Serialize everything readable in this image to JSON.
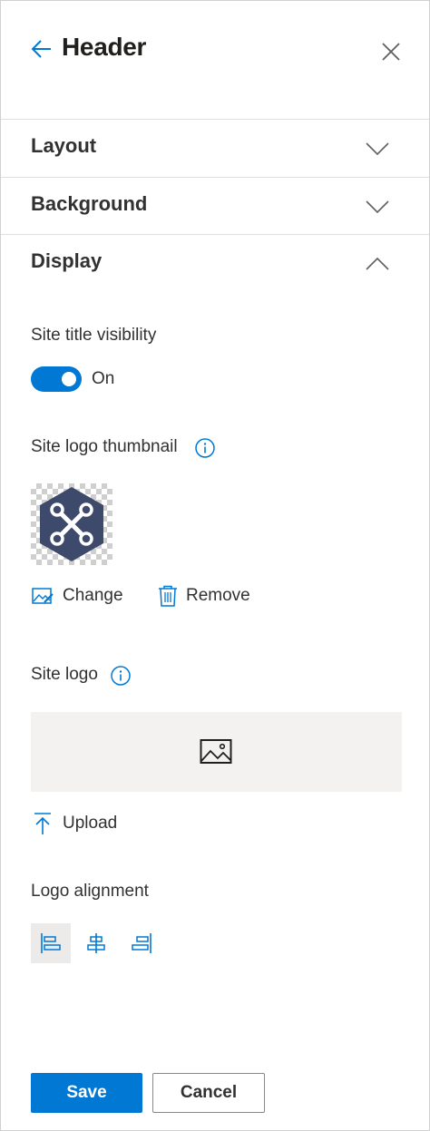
{
  "header": {
    "title": "Header"
  },
  "sections": {
    "layout": {
      "label": "Layout",
      "expanded": false
    },
    "background": {
      "label": "Background",
      "expanded": false
    },
    "display": {
      "label": "Display",
      "expanded": true
    }
  },
  "display": {
    "site_title_visibility": {
      "label": "Site title visibility",
      "toggle_state": "On",
      "checked": true
    },
    "site_logo_thumbnail": {
      "label": "Site logo thumbnail",
      "change_label": "Change",
      "remove_label": "Remove"
    },
    "site_logo": {
      "label": "Site logo",
      "upload_label": "Upload"
    },
    "logo_alignment": {
      "label": "Logo alignment",
      "options": [
        "left",
        "center",
        "right"
      ],
      "selected": "left"
    }
  },
  "footer": {
    "save_label": "Save",
    "cancel_label": "Cancel"
  },
  "colors": {
    "accent": "#0078d4",
    "thumbnail_logo": "#3d4a6b",
    "logo_area_bg": "#f3f2f1"
  },
  "icons": [
    "arrow-left-icon",
    "close-icon",
    "chevron-down-icon",
    "chevron-up-icon",
    "info-icon",
    "image-edit-icon",
    "trash-icon",
    "image-icon",
    "upload-icon",
    "align-left-icon",
    "align-center-icon",
    "align-right-icon"
  ]
}
